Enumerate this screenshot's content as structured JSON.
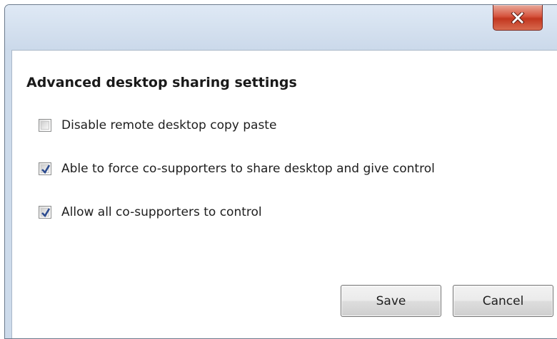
{
  "window": {
    "close_icon": "close-icon"
  },
  "dialog": {
    "heading": "Advanced desktop sharing settings",
    "options": [
      {
        "label": "Disable remote desktop copy paste",
        "checked": false
      },
      {
        "label": "Able to force co-supporters to share desktop and give control",
        "checked": true
      },
      {
        "label": "Allow all co-supporters to control",
        "checked": true
      }
    ],
    "buttons": {
      "save_label": "Save",
      "cancel_label": "Cancel"
    }
  },
  "colors": {
    "close_button": "#c2371f",
    "check_mark": "#2c4b8f"
  }
}
